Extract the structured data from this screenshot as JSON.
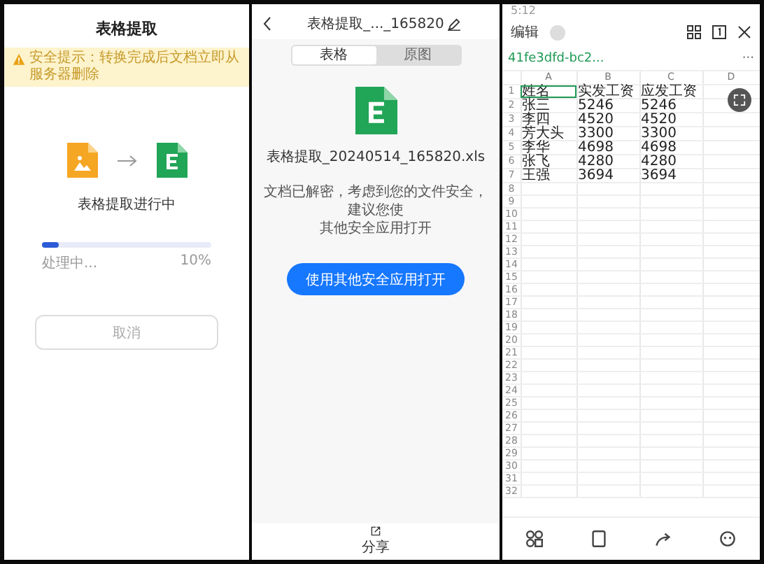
{
  "extract_screen": {
    "title": "表格提取",
    "notice": "安全提示：转换完成后文档立即从服务器删除",
    "status": "表格提取进行中",
    "progress": {
      "level": 0.1,
      "label": "处理中...",
      "reading": "10%"
    },
    "cancel_button": "取消"
  },
  "result_screen": {
    "title": "表格提取_..._165820",
    "tabs": [
      {
        "label": "表格",
        "selected": true
      },
      {
        "label": "原图",
        "selected": false
      }
    ],
    "file_name": "表格提取_20240514_165820.xls",
    "message_lines": [
      "文档已解密，考虑到您的文件安全，建议您使",
      "其他安全应用打开"
    ],
    "open_button": "使用其他安全应用打开",
    "bottom_actions": [
      {
        "label": "分享"
      }
    ]
  },
  "sheet_screen": {
    "clock": "5:12",
    "edit_label": "编辑",
    "file_name": "41fe3dfd-bc2...",
    "more": "···",
    "columns": [
      "A",
      "B",
      "C",
      "D"
    ],
    "rows": [
      {
        "number": "1",
        "cells": [
          {
            "text": "姓名",
            "selected": true
          },
          {
            "text": "实发工资",
            "selected": false
          },
          {
            "text": "应发工资",
            "selected": false
          }
        ]
      },
      {
        "number": "2",
        "cells": [
          {
            "text": "张三",
            "selected": false
          },
          {
            "text": "5246",
            "selected": false
          },
          {
            "text": "5246",
            "selected": false
          }
        ]
      },
      {
        "number": "3",
        "cells": [
          {
            "text": "李四",
            "selected": false
          },
          {
            "text": "4520",
            "selected": false
          },
          {
            "text": "4520",
            "selected": false
          }
        ]
      },
      {
        "number": "4",
        "cells": [
          {
            "text": "芳大头",
            "selected": false
          },
          {
            "text": "3300",
            "selected": false
          },
          {
            "text": "3300",
            "selected": false
          }
        ]
      },
      {
        "number": "5",
        "cells": [
          {
            "text": "李华",
            "selected": false
          },
          {
            "text": "4698",
            "selected": false
          },
          {
            "text": "4698",
            "selected": false
          }
        ]
      },
      {
        "number": "6",
        "cells": [
          {
            "text": "张飞",
            "selected": false
          },
          {
            "text": "4280",
            "selected": false
          },
          {
            "text": "4280",
            "selected": false
          }
        ]
      },
      {
        "number": "7",
        "cells": [
          {
            "text": "王强",
            "selected": false
          },
          {
            "text": "3694",
            "selected": false
          },
          {
            "text": "3694",
            "selected": false
          }
        ]
      },
      {
        "number": "8"
      },
      {
        "number": "9"
      },
      {
        "number": "10"
      },
      {
        "number": "11"
      },
      {
        "number": "12"
      },
      {
        "number": "13"
      },
      {
        "number": "14"
      },
      {
        "number": "15"
      },
      {
        "number": "16"
      },
      {
        "number": "17"
      },
      {
        "number": "18"
      },
      {
        "number": "19"
      },
      {
        "number": "20"
      },
      {
        "number": "21"
      },
      {
        "number": "22"
      },
      {
        "number": "23"
      },
      {
        "number": "24"
      },
      {
        "number": "25"
      },
      {
        "number": "26"
      },
      {
        "number": "27"
      },
      {
        "number": "28"
      },
      {
        "number": "29"
      },
      {
        "number": "30"
      },
      {
        "number": "31"
      },
      {
        "number": "32"
      }
    ]
  }
}
